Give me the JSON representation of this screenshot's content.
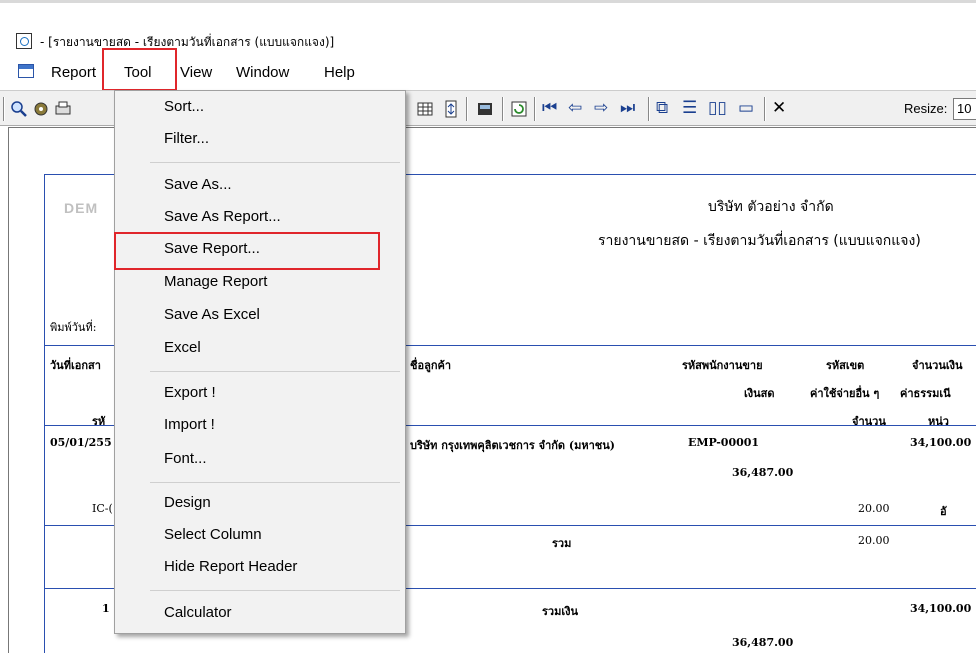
{
  "window": {
    "title": " - [รายงานขายสด - เรียงตามวันที่เอกสาร (แบบแจกแจง)]"
  },
  "menubar": [
    "Report",
    "Tool",
    "View",
    "Window",
    "Help"
  ],
  "toolbar": {
    "resize_label": "Resize:",
    "resize_value": "10"
  },
  "tool_menu": {
    "items": [
      "Sort...",
      "Filter...",
      "Save As...",
      "Save As Report...",
      "Save Report...",
      "Manage Report",
      "Save As Excel",
      "Excel",
      "Export !",
      "Import !",
      "Font...",
      "Design",
      "Select Column",
      "Hide Report Header",
      "Calculator"
    ]
  },
  "report": {
    "watermark": "DEM",
    "company": "บริษัท ตัวอย่าง จำกัด",
    "title": "รายงานขายสด - เรียงตามวันที่เอกสาร (แบบแจกแจง)",
    "print_date_label": "พิมพ์วันที่:",
    "headers": {
      "doc_date": "วันที่เอกสา",
      "customer": "ชื่อลูกค้า",
      "salesman": "รหัสพนักงานขาย",
      "zone": "รหัสเขต",
      "amount": "จำนวนเงิน",
      "cash": "เงินสด",
      "other_exp": "ค่าใช้จ่ายอื่น ๆ",
      "fee": "ค่าธรรมเนี",
      "code": "รหั",
      "qty": "จำนวน",
      "unit": "หน่ว"
    },
    "rows": {
      "date": "05/01/255",
      "customer": "บริษัท กรุงเทพคุลิตเวชการ จำกัด (มหาชน)",
      "emp": "EMP-00001",
      "amount": "34,100.00",
      "cash": "36,487.00",
      "item_code": "IC-(",
      "item_qty": "20.00",
      "item_tail": "อั",
      "sum_label": "รวม",
      "sum_qty": "20.00",
      "total_label": "รวมเงิน",
      "total_amount": "34,100.00",
      "total_cash": "36,487.00",
      "total_num": "1"
    }
  }
}
